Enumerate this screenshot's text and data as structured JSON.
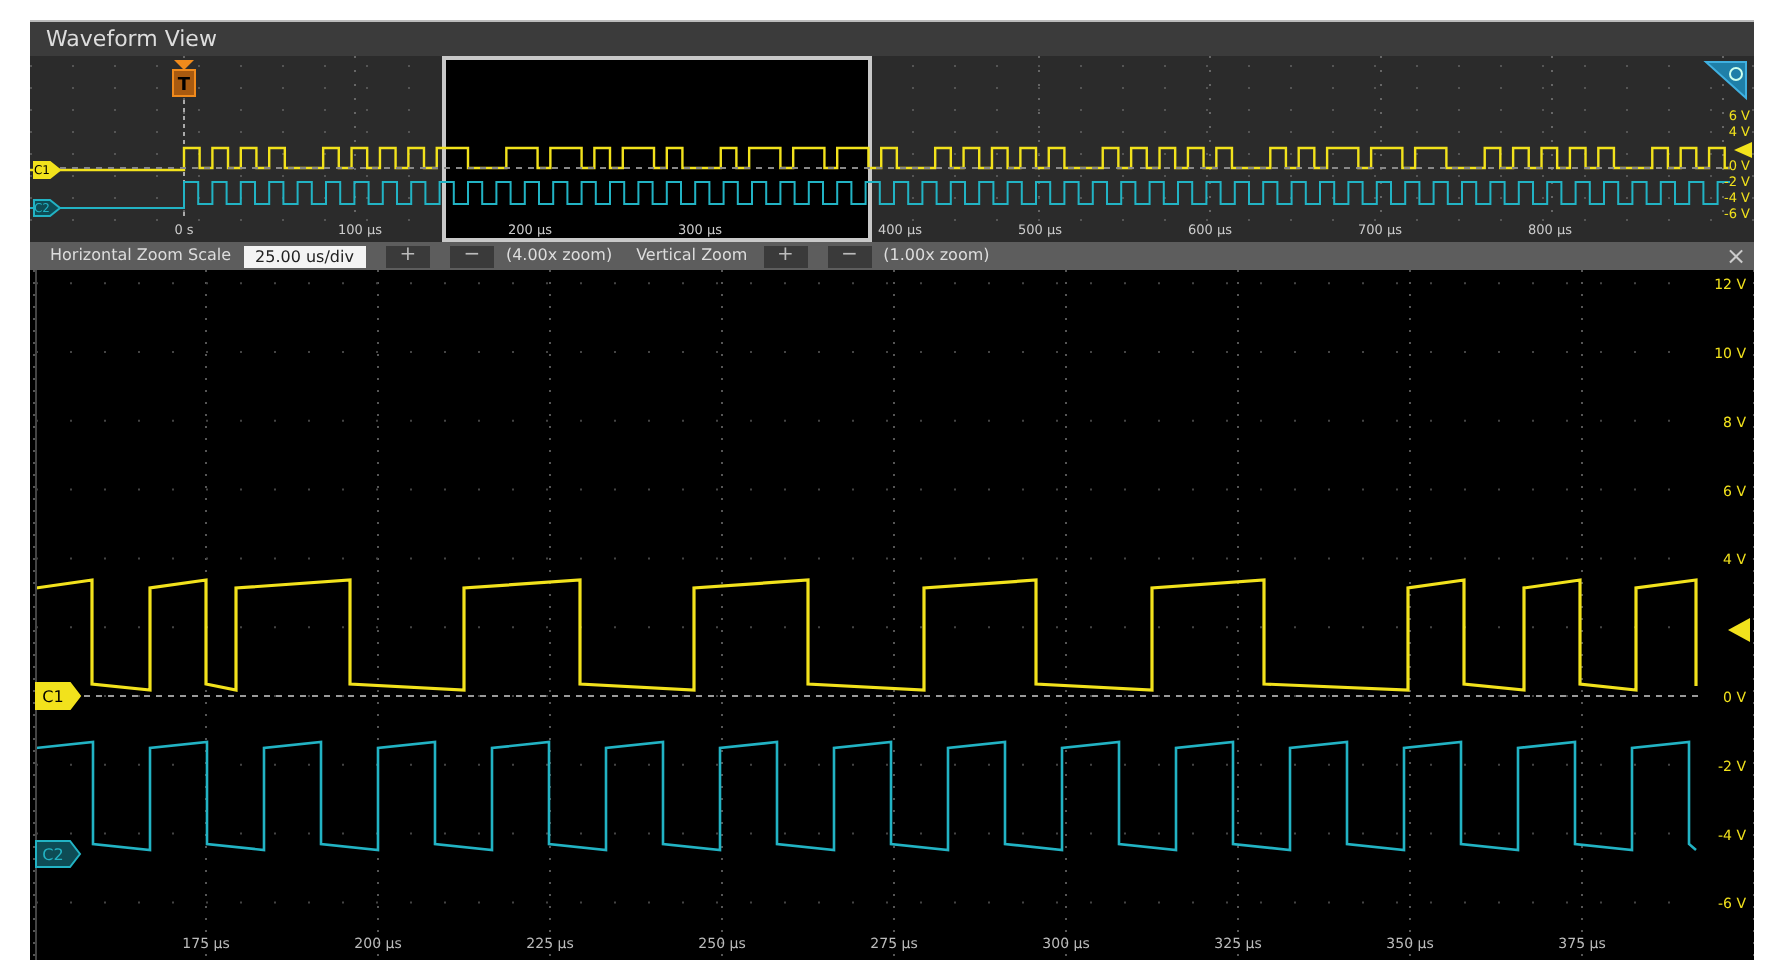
{
  "window": {
    "title": "Waveform View"
  },
  "overview": {
    "trigger": "T",
    "time_labels": [
      "0 s",
      "100 µs",
      "200 µs",
      "300 µs",
      "400 µs",
      "500 µs",
      "600 µs",
      "700 µs",
      "800 µs"
    ],
    "volt_labels": [
      "6 V",
      "4 V",
      "0 V",
      "-2 V",
      "-4 V",
      "-6 V"
    ],
    "channels": [
      {
        "label": "C1",
        "color": "#f2e21c"
      },
      {
        "label": "C2",
        "color": "#22b3c4"
      }
    ]
  },
  "toolbar": {
    "h_label": "Horizontal Zoom Scale",
    "h_value": "25.00 us/div",
    "h_plus": "+",
    "h_minus": "−",
    "h_zoom": "(4.00x zoom)",
    "v_label": "Vertical Zoom",
    "v_plus": "+",
    "v_minus": "−",
    "v_zoom": "(1.00x zoom)",
    "close": "×"
  },
  "main": {
    "time_labels": [
      "175 µs",
      "200 µs",
      "225 µs",
      "250 µs",
      "275 µs",
      "300 µs",
      "325 µs",
      "350 µs",
      "375 µs"
    ],
    "volt_labels": [
      "12 V",
      "10 V",
      "8 V",
      "6 V",
      "4 V",
      "0 V",
      "-2 V",
      "-4 V",
      "-6 V"
    ],
    "channels": [
      {
        "label": "C1",
        "color": "#f2e21c"
      },
      {
        "label": "C2",
        "color": "#22b3c4"
      }
    ]
  }
}
